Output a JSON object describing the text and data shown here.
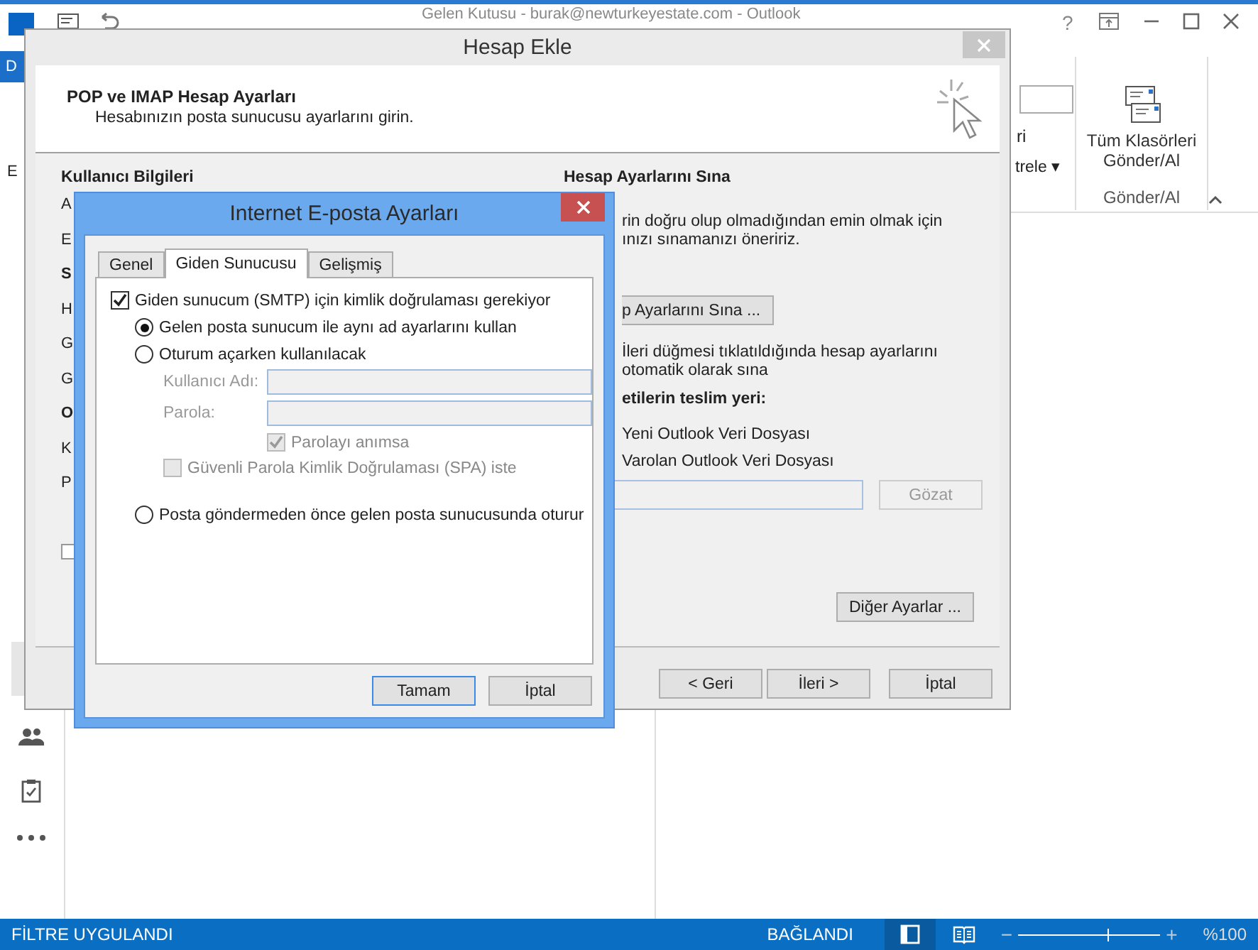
{
  "outlook": {
    "title": "Gelen Kutusu - burak@newturkeyestate.com - Outlook",
    "help": "?",
    "file_tab": "D",
    "left_fragment": "E"
  },
  "ribbon": {
    "fragment_1": "ri",
    "fragment_2": "trele ▾",
    "send_receive_all": "Tüm Klasörleri Gönder/Al",
    "group_label": "Gönder/Al"
  },
  "status_bar": {
    "filter": "FİLTRE UYGULANDI",
    "connection": "BAĞLANDI",
    "zoom": "%100",
    "zoom_out": "−",
    "zoom_in": "+",
    "zoom_slider": {
      "level": 0.63
    }
  },
  "add_account": {
    "title": "Hesap Ekle",
    "heading": "POP ve IMAP Hesap Ayarları",
    "subheading": "Hesabınızın posta sunucusu ayarlarını girin.",
    "left_heading": "Kullanıcı Bilgileri",
    "left_fragments": [
      {
        "text": "A",
        "bold": false
      },
      {
        "text": "E",
        "bold": false
      },
      {
        "text": "S",
        "bold": true
      },
      {
        "text": "H",
        "bold": false
      },
      {
        "text": "G",
        "bold": false
      },
      {
        "text": "G",
        "bold": false
      },
      {
        "text": "O",
        "bold": true
      },
      {
        "text": "K",
        "bold": false
      },
      {
        "text": "P",
        "bold": false
      }
    ],
    "left_checkbox": {
      "checked": false
    },
    "test_heading": "Hesap Ayarlarını Sına",
    "test_text": [
      "rin doğru olup olmadığından emin olmak için",
      "ınızı sınamanızı öneririz."
    ],
    "test_button": "p Ayarlarını Sına ...",
    "auto_test": [
      "İleri düğmesi tıklatıldığında hesap ayarlarını",
      "otomatik olarak sına"
    ],
    "delivery_heading": "etilerin teslim yeri:",
    "delivery_options": [
      "Yeni Outlook Veri Dosyası",
      "Varolan Outlook Veri Dosyası"
    ],
    "browse_button": {
      "label": "Gözat",
      "disabled": true
    },
    "more_settings_button": "Diğer Ayarlar ...",
    "buttons": [
      "< Geri",
      "İleri >",
      "İptal"
    ]
  },
  "internet_settings": {
    "title": "Internet E-posta Ayarları",
    "tabs": [
      {
        "label": "Genel",
        "selected": false
      },
      {
        "label": "Giden Sunucusu",
        "selected": true
      },
      {
        "label": "Gelişmiş",
        "selected": false
      }
    ],
    "smtp_auth": {
      "label": "Giden sunucum (SMTP) için kimlik doğrulaması gerekiyor",
      "checked": true
    },
    "options": [
      {
        "kind": "radio",
        "label": "Gelen posta sunucum ile aynı ad ayarlarını kullan",
        "selected": true
      },
      {
        "kind": "radio",
        "label": "Oturum açarken kullanılacak",
        "selected": false
      },
      {
        "kind": "field",
        "label": "Kullanıcı Adı:",
        "disabled": true
      },
      {
        "kind": "field",
        "label": "Parola:",
        "disabled": true
      },
      {
        "kind": "checkbox",
        "label": "Parolayı anımsa",
        "checked": true,
        "disabled": true
      },
      {
        "kind": "checkbox",
        "label": "Güvenli Parola Kimlik Doğrulaması (SPA) iste",
        "checked": false,
        "disabled": true
      },
      {
        "kind": "radio",
        "label": "Posta göndermeden önce gelen posta sunucusunda oturur",
        "selected": false
      }
    ],
    "buttons": [
      {
        "label": "Tamam",
        "default": true
      },
      {
        "label": "İptal",
        "default": false
      }
    ]
  }
}
